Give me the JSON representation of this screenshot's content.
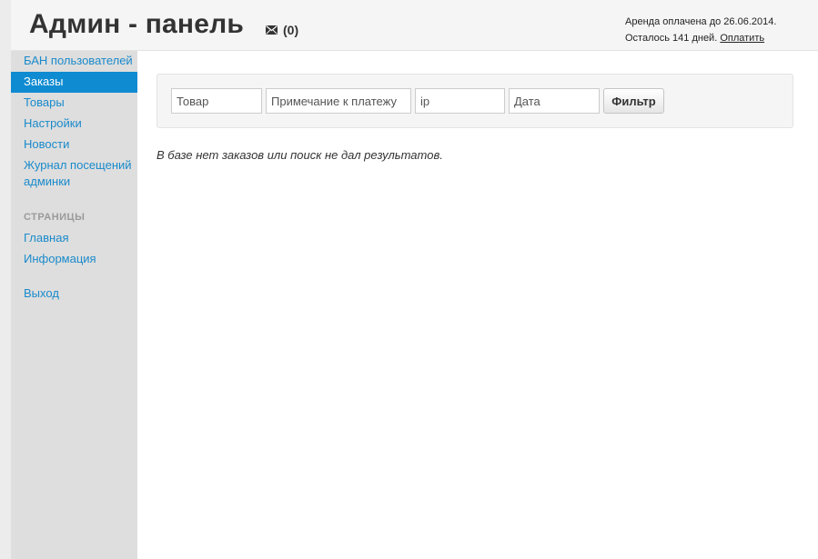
{
  "header": {
    "title": "Админ - панель",
    "messages_count": "(0)",
    "rent_line1": "Аренда оплачена до 26.06.2014.",
    "rent_line2_prefix": "Осталось 141 дней.",
    "pay_link": "Оплатить"
  },
  "sidebar": {
    "items": [
      {
        "label": "БАН пользователей",
        "active": false
      },
      {
        "label": "Заказы",
        "active": true
      },
      {
        "label": "Товары",
        "active": false
      },
      {
        "label": "Настройки",
        "active": false
      },
      {
        "label": "Новости",
        "active": false
      },
      {
        "label": "Журнал посещений админки",
        "active": false
      }
    ],
    "pages_header": "СТРАНИЦЫ",
    "pages": [
      {
        "label": "Главная"
      },
      {
        "label": "Информация"
      }
    ],
    "logout": "Выход"
  },
  "filter": {
    "product_placeholder": "Товар",
    "note_placeholder": "Примечание к платежу",
    "ip_placeholder": "ip",
    "date_placeholder": "Дата",
    "button_label": "Фильтр"
  },
  "main": {
    "empty_message": "В базе нет заказов или поиск не дал результатов."
  },
  "colors": {
    "accent": "#0f8bd1",
    "link": "#1a8acb",
    "sidebar_bg": "#dedede",
    "header_bg": "#f5f5f5"
  },
  "icons": {
    "mail": "envelope-icon"
  }
}
